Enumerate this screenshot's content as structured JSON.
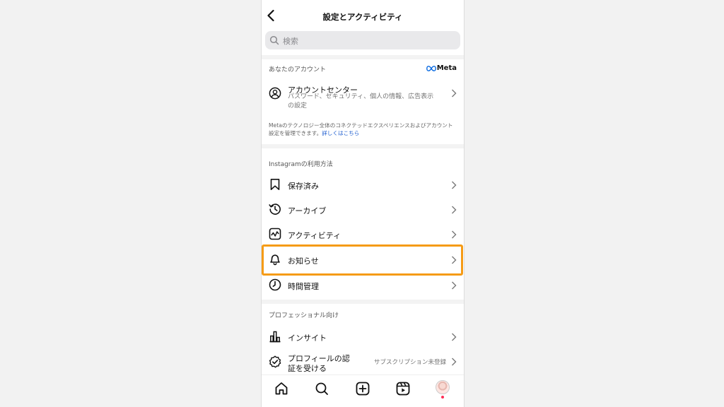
{
  "header": {
    "title": "設定とアクティビティ"
  },
  "search": {
    "placeholder": "検索"
  },
  "account_section": {
    "title": "あなたのアカウント",
    "brand": "Meta",
    "account_center": {
      "label": "アカウントセンター",
      "subtitle": "パスワード、セキュリティ、個人の情報、広告表示の設定"
    },
    "note": "Metaのテクノロジー全体のコネクテッドエクスペリエンスおよびアカウント設定を管理できます。",
    "note_link": "詳しくはこちら"
  },
  "usage_section": {
    "title": "Instagramの利用方法",
    "items": [
      {
        "label": "保存済み",
        "icon": "bookmark-icon"
      },
      {
        "label": "アーカイブ",
        "icon": "archive-history-icon"
      },
      {
        "label": "アクティビティ",
        "icon": "activity-chart-icon"
      },
      {
        "label": "お知らせ",
        "icon": "bell-icon"
      },
      {
        "label": "時間管理",
        "icon": "clock-icon"
      }
    ]
  },
  "pro_section": {
    "title": "プロフェッショナル向け",
    "items": [
      {
        "label": "インサイト",
        "icon": "bar-chart-icon"
      },
      {
        "label": "プロフィールの認証を受ける",
        "icon": "verified-badge-icon",
        "value": "サブスクリプション未登録"
      }
    ]
  },
  "tabbar": {
    "tabs": [
      "home-icon",
      "search-icon",
      "create-icon",
      "reels-icon",
      "profile-avatar"
    ]
  },
  "colors": {
    "highlight": "#f59b16",
    "link": "#1c5ccf",
    "notification_dot": "#ff2d55"
  }
}
